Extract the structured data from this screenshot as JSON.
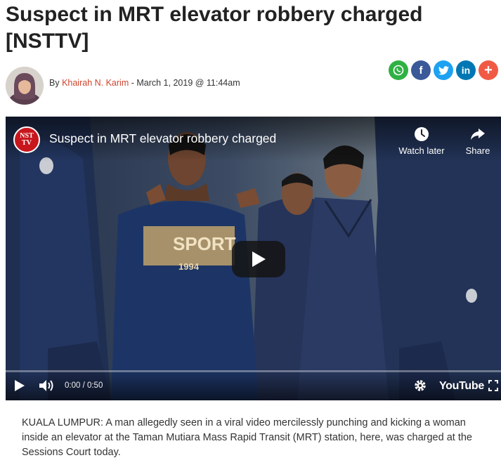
{
  "article": {
    "headline": "Suspect in MRT elevator robbery charged [NSTTV]",
    "byline_prefix": "By ",
    "author": "Khairah N. Karim",
    "byline_suffix": " - March 1, 2019 @ 11:44am",
    "body": "KUALA LUMPUR: A man allegedly seen in a viral video mercilessly punching and kicking a woman inside an elevator at the Taman Mutiara Mass Rapid Transit (MRT) station, here, was charged at the Sessions Court today."
  },
  "share": {
    "buttons": [
      {
        "name": "whatsapp",
        "glyph": "✆",
        "color": "#2fb143"
      },
      {
        "name": "facebook",
        "glyph": "f",
        "color": "#3b5998"
      },
      {
        "name": "twitter",
        "glyph": "t",
        "color": "#1da1f2"
      },
      {
        "name": "linkedin",
        "glyph": "in",
        "color": "#0077b5"
      },
      {
        "name": "more",
        "glyph": "+",
        "color": "#f05a45"
      }
    ]
  },
  "video": {
    "channel_logo_line1": "NST",
    "channel_logo_line2": "TV",
    "title": "Suspect in MRT elevator robbery charged",
    "watch_later_label": "Watch later",
    "share_label": "Share",
    "time_display": "0:00 / 0:50",
    "youtube_label": "YouTube",
    "shirt_text": "SPORT",
    "shirt_year": "1994",
    "progress": 0.0
  }
}
